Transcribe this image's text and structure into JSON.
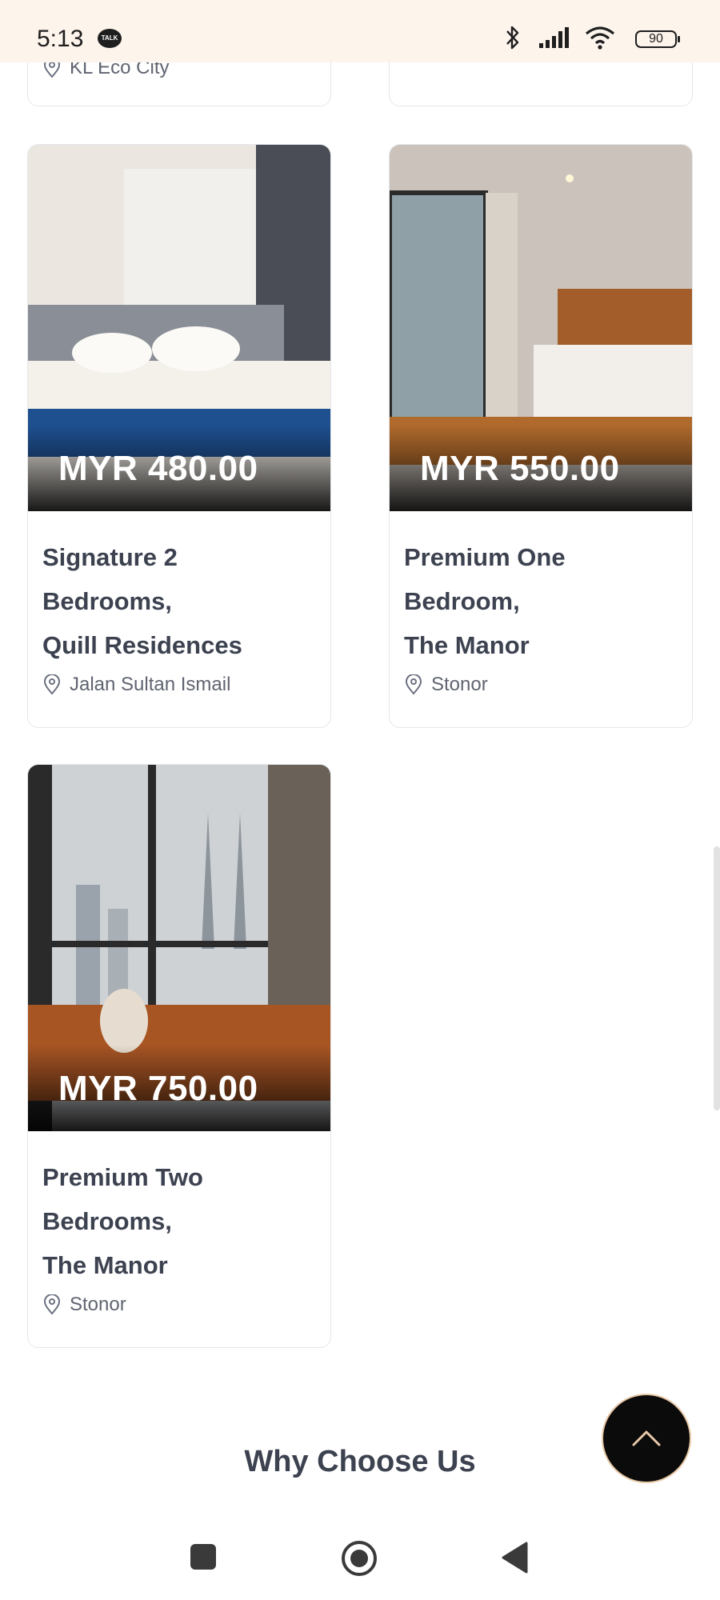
{
  "status_bar": {
    "time": "5:13",
    "notification_badge": "TALK",
    "battery_level": "90",
    "icons": [
      "bluetooth-icon",
      "signal-icon",
      "wifi-icon",
      "battery-icon"
    ]
  },
  "top_cards": {
    "left": {
      "location": "KL Eco City"
    }
  },
  "listings": [
    {
      "price": "MYR 480.00",
      "title": "Signature 2\nBedrooms,\nQuill Residences",
      "location": "Jalan Sultan Ismail"
    },
    {
      "price": "MYR 550.00",
      "title": "Premium One\nBedroom,\nThe Manor",
      "location": "Stonor"
    },
    {
      "price": "MYR 750.00",
      "title": "Premium Two\nBedrooms,\nThe Manor",
      "location": "Stonor"
    }
  ],
  "section": {
    "heading": "Why Choose Us"
  },
  "fab": {
    "icon": "chevron-up-icon"
  },
  "nav_bar": {
    "icons": [
      "recent-apps-icon",
      "home-icon",
      "back-icon"
    ]
  },
  "colors": {
    "accent": "#e8c9a8",
    "price_text": "#ffffff",
    "dark": "#0b0b0b"
  }
}
